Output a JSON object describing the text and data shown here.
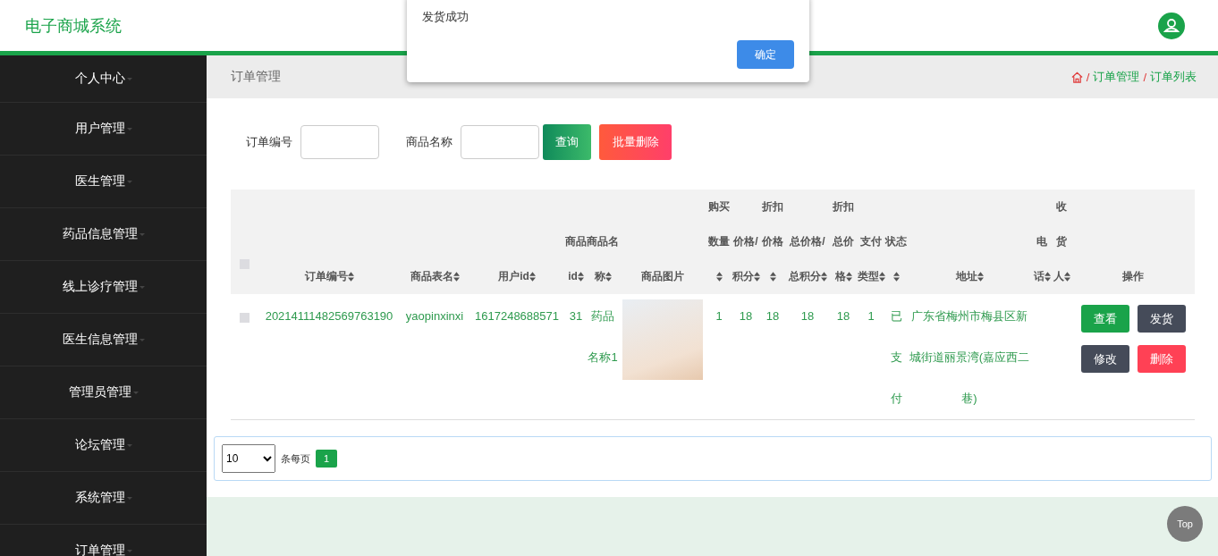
{
  "header": {
    "title": "电子商城系统"
  },
  "sidebar": {
    "items": [
      {
        "label": "个人中心"
      },
      {
        "label": "用户管理"
      },
      {
        "label": "医生管理"
      },
      {
        "label": "药品信息管理"
      },
      {
        "label": "线上诊疗管理"
      },
      {
        "label": "医生信息管理"
      },
      {
        "label": "管理员管理"
      },
      {
        "label": "论坛管理"
      },
      {
        "label": "系统管理"
      },
      {
        "label": "订单管理"
      }
    ]
  },
  "page_title": "订单管理",
  "breadcrumb": [
    {
      "separator": "/",
      "label": "订单管理"
    },
    {
      "separator": "/",
      "label": "订单列表"
    }
  ],
  "search": {
    "fields": [
      {
        "label": "订单编号"
      },
      {
        "label": "商品名称"
      }
    ],
    "query_button": "查询",
    "batch_delete_button": "批量删除"
  },
  "table": {
    "all_checked": false,
    "columns": [
      {
        "label": "订单编号",
        "sortable": true
      },
      {
        "label": "商品表名",
        "sortable": true
      },
      {
        "label": "用户id",
        "sortable": true
      },
      {
        "label": "商品id",
        "sortable": true
      },
      {
        "label": "商品名称",
        "sortable": true
      },
      {
        "label": "商品图片",
        "sortable": false
      },
      {
        "label": "购买数量",
        "sortable": true
      },
      {
        "label": "价格/积分",
        "sortable": true
      },
      {
        "label": "折扣价格",
        "sortable": true
      },
      {
        "label": "总价格/总积分",
        "sortable": true
      },
      {
        "label": "折扣总价格",
        "sortable": true
      },
      {
        "label": "支付类型",
        "sortable": true
      },
      {
        "label": "状态",
        "sortable": true
      },
      {
        "label": "地址",
        "sortable": true
      },
      {
        "label": "电话",
        "sortable": true
      },
      {
        "label": "收货人",
        "sortable": true
      },
      {
        "label": "操作",
        "sortable": false
      }
    ],
    "rows": [
      {
        "checked": false,
        "cells": [
          "20214111482569763190",
          "yaopinxinxi",
          "1617248688571",
          "31",
          "药品名称1",
          null,
          "1",
          "18",
          "18",
          "18",
          "18",
          "1",
          "已支付",
          "广东省梅州市梅县区新城街道丽景湾(嘉应西二巷)",
          "",
          ""
        ],
        "actions": [
          "查看",
          "发货",
          "修改",
          "删除"
        ]
      }
    ]
  },
  "pagination": {
    "page_size": "10",
    "page_size_label": "条每页",
    "pages": [
      {
        "label": "1",
        "selected": true
      }
    ]
  },
  "top_button": "Top",
  "dialog": {
    "message": "发货成功",
    "confirm": "确定"
  }
}
